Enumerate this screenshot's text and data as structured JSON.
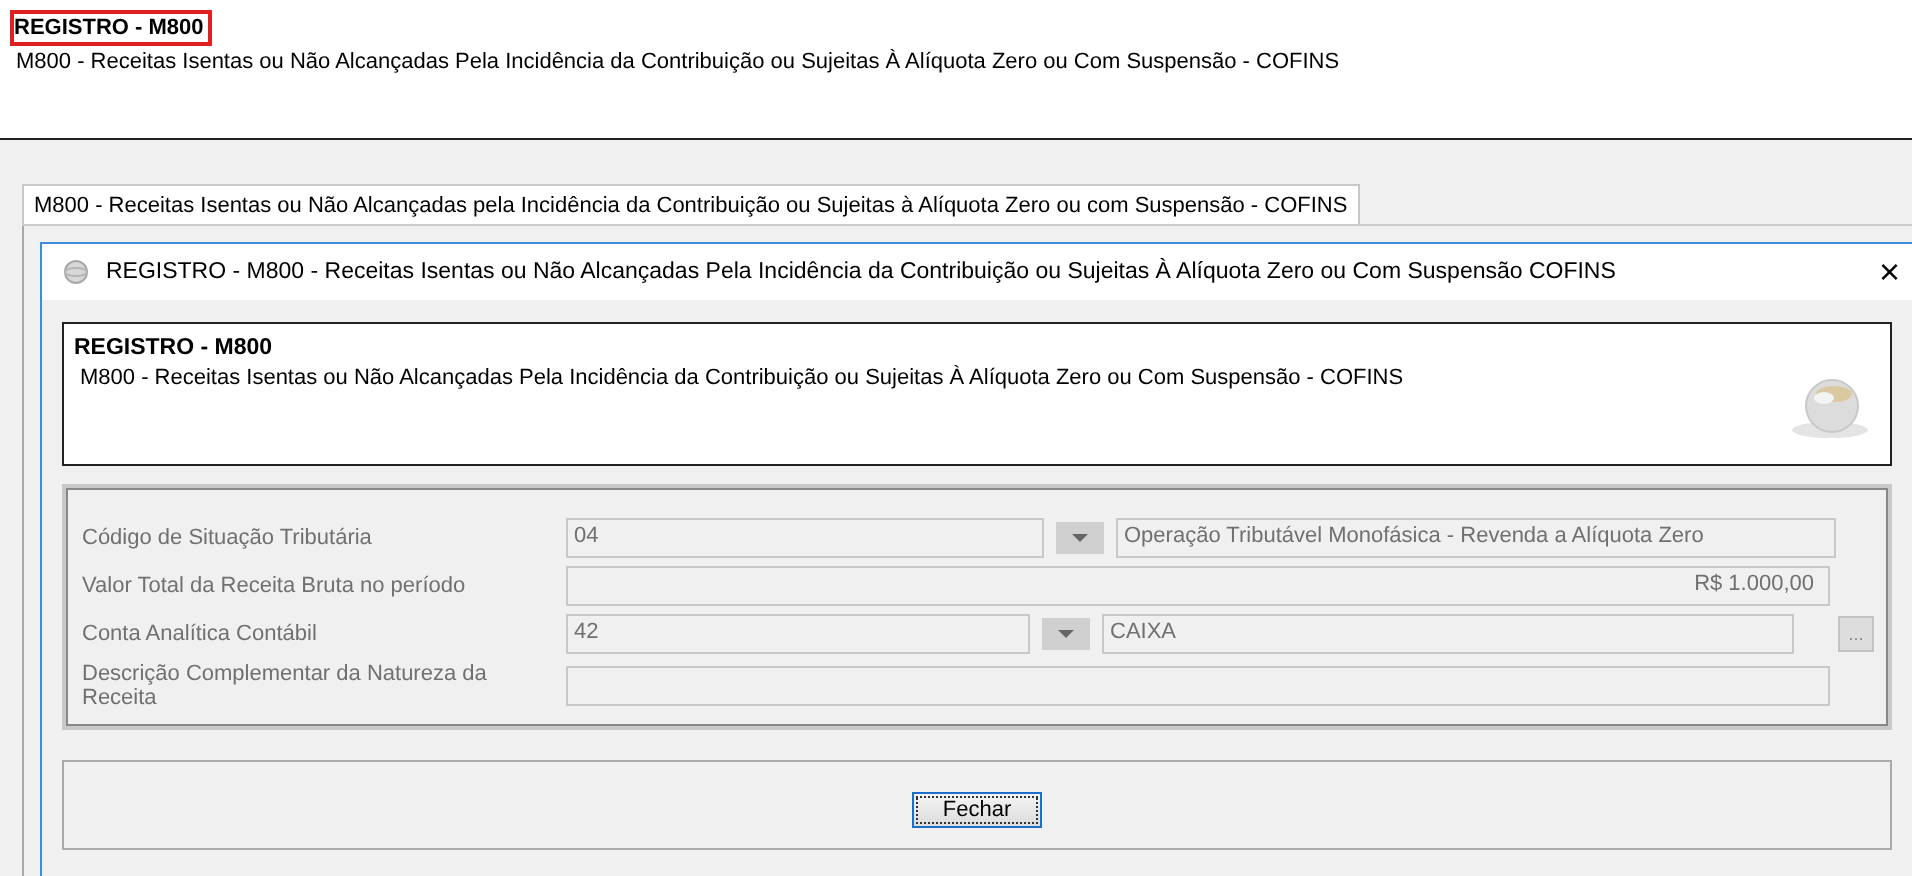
{
  "header": {
    "title": "REGISTRO - M800",
    "subtitle": "M800 - Receitas Isentas ou Não Alcançadas Pela Incidência da Contribuição ou Sujeitas À Alíquota Zero ou Com Suspensão - COFINS"
  },
  "tabs": [
    {
      "label": "M800 - Receitas Isentas ou Não Alcançadas pela Incidência da Contribuição ou Sujeitas à Alíquota Zero ou com Suspensão - COFINS",
      "selected": true
    }
  ],
  "dialog": {
    "title": "REGISTRO - M800 - Receitas Isentas ou Não Alcançadas Pela Incidência da Contribuição ou Sujeitas À Alíquota Zero ou Com Suspensão  COFINS",
    "close": "×",
    "banner": {
      "title": "REGISTRO - M800",
      "subtitle": "M800 - Receitas Isentas ou Não Alcançadas Pela Incidência da Contribuição ou Sujeitas À Alíquota Zero ou Com Suspensão - COFINS"
    },
    "disabled": true,
    "fields": [
      {
        "kind": "combo",
        "label": "Código de Situação Tributária",
        "value": "04",
        "description": "Operação Tributável Monofásica - Revenda a Alíquota Zero"
      },
      {
        "kind": "amount",
        "label": "Valor Total da Receita Bruta no período",
        "value": "R$ 1.000,00"
      },
      {
        "kind": "lookup",
        "label": "Conta Analítica Contábil",
        "value": "42",
        "description": "CAIXA",
        "button": "..."
      },
      {
        "kind": "text",
        "label": "Descrição Complementar da Natureza da Receita"
      }
    ],
    "buttons": [
      "Fechar"
    ]
  }
}
